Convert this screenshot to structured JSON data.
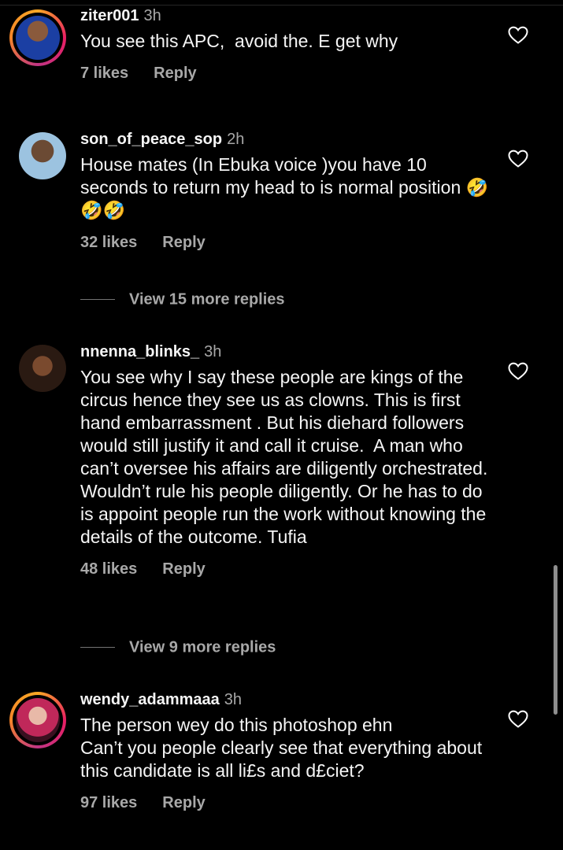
{
  "colors": {
    "background": "#000000",
    "primary_text": "#f5f5f5",
    "secondary_text": "#a8a8a8",
    "story_ring": "#e91e63"
  },
  "comments": [
    {
      "username": "ziter001",
      "time": "3h",
      "text": "You see this APC,  avoid the. E get why",
      "likes": "7 likes",
      "reply": "Reply",
      "avatar": "avatar-with-story-ring"
    },
    {
      "username": "son_of_peace_sop",
      "time": "2h",
      "text": "House mates (In Ebuka voice )you have 10 seconds to return my head to is normal position 🤣🤣🤣",
      "likes": "32 likes",
      "reply": "Reply",
      "avatar": "avatar"
    },
    {
      "username": "nnenna_blinks_",
      "time": "3h",
      "text": "You see why I say these people are kings of the circus hence they see us as clowns. This is first hand embarrassment . But his diehard followers would still justify it and call it cruise.  A man who can’t oversee his affairs are diligently orchestrated. Wouldn’t rule his people diligently. Or he has to do is appoint people run the work without knowing the details of the outcome. Tufia",
      "likes": "48 likes",
      "reply": "Reply",
      "avatar": "avatar"
    },
    {
      "username": "wendy_adammaaa",
      "time": "3h",
      "text": "The person wey do this photoshop ehn\nCan’t you people clearly see that everything about this candidate is all li£s and d£ciet?",
      "likes": "97 likes",
      "reply": "Reply",
      "avatar": "avatar-with-story-ring"
    }
  ],
  "view_more": [
    "View 15 more replies",
    "View 9 more replies"
  ],
  "icons": {
    "like": "heart-outline-icon"
  }
}
